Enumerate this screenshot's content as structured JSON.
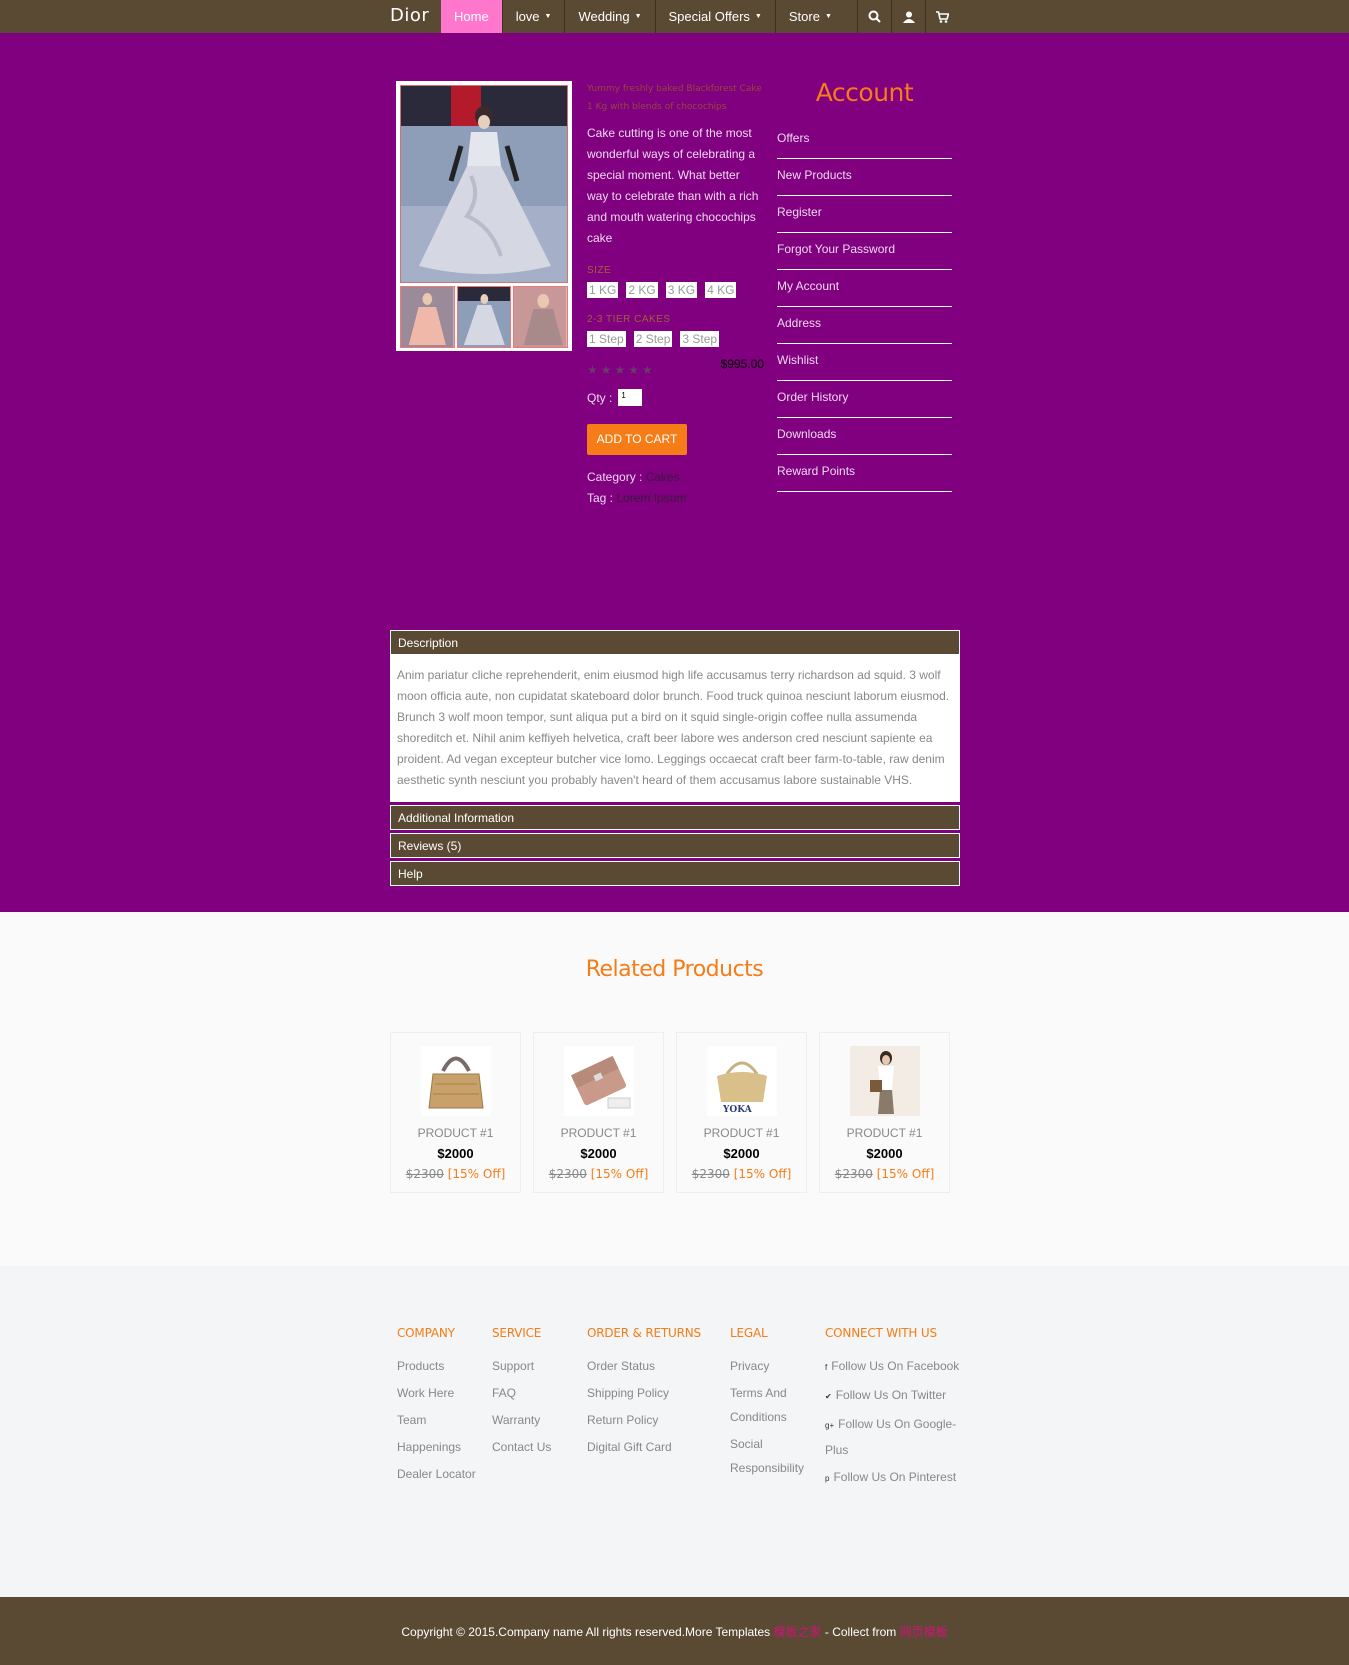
{
  "navbar": {
    "brand": "Dior",
    "items": [
      {
        "label": "Home",
        "has_caret": false
      },
      {
        "label": "love",
        "has_caret": true
      },
      {
        "label": "Wedding",
        "has_caret": true
      },
      {
        "label": "Special Offers",
        "has_caret": true
      },
      {
        "label": "Store",
        "has_caret": true
      }
    ],
    "icons": [
      "search-icon",
      "user-icon",
      "cart-icon"
    ]
  },
  "product": {
    "promo": "Yummy freshly baked Blackforest Cake 1 Kg with blends of chocochips",
    "lead": "Cake cutting is one of the most wonderful ways of celebrating a special moment. What better way to celebrate than with a rich and mouth watering chocochips cake",
    "size_label": "SIZE",
    "sizes": [
      "1 KG",
      "2 KG",
      "3 KG",
      "4 KG"
    ],
    "tier_label": "2-3 TIER CAKES",
    "tiers": [
      "1 Step",
      "2 Step",
      "3 Step"
    ],
    "stars": "★★★★★",
    "price": "$995.00",
    "qty_label": "Qty :",
    "qty_value": "1",
    "add_to_cart": "ADD TO CART",
    "category_label": "Category :",
    "category_value": "Cakes",
    "tag_label": "Tag :",
    "tag_value": "Lorem Ipsum"
  },
  "account": {
    "title": "Account",
    "items": [
      "Offers",
      "New Products",
      "Register",
      "Forgot Your Password",
      "My Account",
      "Address",
      "Wishlist",
      "Order History",
      "Downloads",
      "Reward Points"
    ]
  },
  "accordion": {
    "description_title": "Description",
    "description_body": "Anim pariatur cliche reprehenderit, enim eiusmod high life accusamus terry richardson ad squid. 3 wolf moon officia aute, non cupidatat skateboard dolor brunch. Food truck quinoa nesciunt laborum eiusmod. Brunch 3 wolf moon tempor, sunt aliqua put a bird on it squid single-origin coffee nulla assumenda shoreditch et. Nihil anim keffiyeh helvetica, craft beer labore wes anderson cred nesciunt sapiente ea proident. Ad vegan excepteur butcher vice lomo. Leggings occaecat craft beer farm-to-table, raw denim aesthetic synth nesciunt you probably haven't heard of them accusamus labore sustainable VHS.",
    "additional_title": "Additional Information",
    "reviews_title": "Reviews (5)",
    "help_title": "Help"
  },
  "related": {
    "title": "Related Products",
    "products": [
      {
        "name": "PRODUCT #1",
        "price": "$2000",
        "old_price": "$2300",
        "discount": "[15% Off]",
        "image": "handbag-woven"
      },
      {
        "name": "PRODUCT #1",
        "price": "$2000",
        "old_price": "$2300",
        "discount": "[15% Off]",
        "image": "wallet-pink"
      },
      {
        "name": "PRODUCT #1",
        "price": "$2000",
        "old_price": "$2300",
        "discount": "[15% Off]",
        "image": "handbag-gold"
      },
      {
        "name": "PRODUCT #1",
        "price": "$2000",
        "old_price": "$2300",
        "discount": "[15% Off]",
        "image": "model-bag"
      }
    ]
  },
  "footer": {
    "company": {
      "title": "COMPANY",
      "links": [
        "Products",
        "Work Here",
        "Team",
        "Happenings",
        "Dealer Locator"
      ]
    },
    "service": {
      "title": "SERVICE",
      "links": [
        "Support",
        "FAQ",
        "Warranty",
        "Contact Us"
      ]
    },
    "orders": {
      "title": "ORDER & RETURNS",
      "links": [
        "Order Status",
        "Shipping Policy",
        "Return Policy",
        "Digital Gift Card"
      ]
    },
    "legal": {
      "title": "LEGAL",
      "links": [
        "Privacy",
        "Terms And Conditions",
        "Social Responsibility"
      ]
    },
    "connect": {
      "title": "CONNECT WITH US",
      "links": [
        {
          "icon": "facebook-icon",
          "glyph": "f",
          "label": "Follow Us On Facebook"
        },
        {
          "icon": "twitter-icon",
          "glyph": "✔",
          "label": "Follow Us On Twitter"
        },
        {
          "icon": "google-plus-icon",
          "glyph": "g+",
          "label": "Follow Us On Google-Plus"
        },
        {
          "icon": "pinterest-icon",
          "glyph": "p",
          "label": "Follow Us On Pinterest"
        }
      ]
    }
  },
  "copyright": {
    "text": "Copyright © 2015.Company name All rights reserved.More Templates",
    "link1": "模板之家",
    "mid": "- Collect from",
    "link2": "网页模板"
  },
  "colors": {
    "page_bg": "#800080",
    "brown": "#5b4a33",
    "accent_orange": "#f57c17",
    "active_pink": "#ff77cc"
  }
}
